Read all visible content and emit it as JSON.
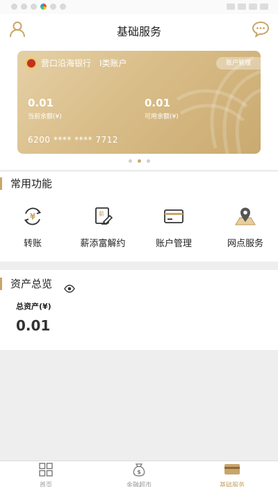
{
  "header": {
    "title": "基础服务",
    "user_icon": "user-icon",
    "chat_icon": "chat-icon"
  },
  "card": {
    "bank_name": "营口沿海银行",
    "account_type": "Ⅰ类账户",
    "manage_label": "账户管理",
    "current_balance": "0.01",
    "current_balance_label": "当前余额(¥)",
    "available_balance": "0.01",
    "available_balance_label": "可用余额(¥)",
    "account_number": "6200 **** **** 7712",
    "page_count": 3,
    "active_page": 1
  },
  "common": {
    "title": "常用功能",
    "items": [
      {
        "label": "转账",
        "icon": "transfer-icon"
      },
      {
        "label": "薪添富解约",
        "icon": "salary-cancel-icon"
      },
      {
        "label": "账户管理",
        "icon": "card-icon"
      },
      {
        "label": "网点服务",
        "icon": "map-pin-icon"
      }
    ]
  },
  "assets": {
    "title": "资产总览",
    "eye_icon": "eye-icon",
    "total_label": "总资产(¥)",
    "total_value": "0.01"
  },
  "tabs": [
    {
      "label": "首页",
      "icon": "grid-icon"
    },
    {
      "label": "金融超市",
      "icon": "money-bag-icon"
    },
    {
      "label": "基础服务",
      "icon": "card-icon",
      "active": true
    }
  ],
  "colors": {
    "accent": "#c9a56a",
    "card_gold": "#d9bd88"
  }
}
